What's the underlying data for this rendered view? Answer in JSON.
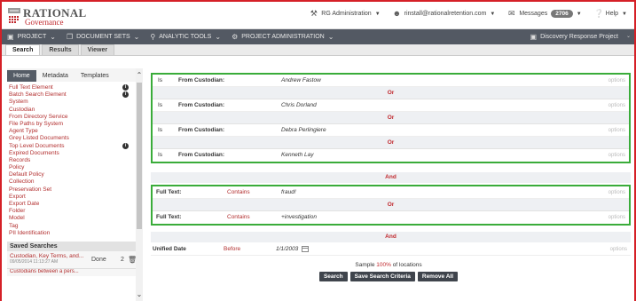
{
  "brand": {
    "name": "RATIONAL",
    "sub": "Governance"
  },
  "header": {
    "admin_label": "RG Administration",
    "user_email": "rinstall@rationalretention.com",
    "messages_label": "Messages",
    "messages_count": "2706",
    "help_label": "Help"
  },
  "nav": {
    "items": [
      "PROJECT",
      "DOCUMENT SETS",
      "ANALYTIC TOOLS",
      "PROJECT ADMINISTRATION"
    ],
    "project_name": "Discovery Response Project"
  },
  "tabs": [
    "Search",
    "Results",
    "Viewer"
  ],
  "left": {
    "subtabs": [
      "Home",
      "Metadata",
      "Templates"
    ],
    "fields": [
      "Full Text Element",
      "Batch Search Element",
      "System",
      "Custodian",
      "From Directory Service",
      "File Paths by System",
      "Agent Type",
      "Grey Listed Documents",
      "Top Level Documents",
      "Expired Documents",
      "Records",
      "Policy",
      "Default Policy",
      "Collection",
      "Preservation Set",
      "Export",
      "Export Date",
      "Folder",
      "Model",
      "Tag",
      "PII Identification"
    ],
    "saved_title": "Saved Searches",
    "saved_items": [
      {
        "name": "Custodian, Key Terms, and...",
        "date": "09/05/2014 11:13:27 AM",
        "status": "Done",
        "count": "2"
      }
    ],
    "saved_more": "Custodians between a pers..."
  },
  "criteria": {
    "custodian_rows": [
      {
        "op": "Is",
        "field": "From Custodian:",
        "value": "Andrew Fastow",
        "options": "options"
      },
      {
        "op": "Is",
        "field": "From Custodian:",
        "value": "Chris Dorland",
        "options": "options"
      },
      {
        "op": "Is",
        "field": "From Custodian:",
        "value": "Debra Perlingiere",
        "options": "options"
      },
      {
        "op": "Is",
        "field": "From Custodian:",
        "value": "Kenneth Lay",
        "options": "options"
      }
    ],
    "or_label": "Or",
    "and_label": "And",
    "fulltext_rows": [
      {
        "field": "Full Text:",
        "op": "Contains",
        "value": "fraud!",
        "options": "options"
      },
      {
        "field": "Full Text:",
        "op": "Contains",
        "value": "+investigation",
        "options": "options"
      }
    ],
    "date_row": {
      "field": "Unified Date",
      "op": "Before",
      "value": "1/1/2003",
      "options": "options"
    }
  },
  "sample": {
    "prefix": "Sample ",
    "pct": "100%",
    "suffix": " of locations"
  },
  "buttons": {
    "search": "Search",
    "save": "Save Search Criteria",
    "remove": "Remove All"
  },
  "colors": {
    "accent": "#c0282d",
    "frame": "#d52027",
    "group_border": "#3aac3a",
    "nav": "#535963"
  }
}
